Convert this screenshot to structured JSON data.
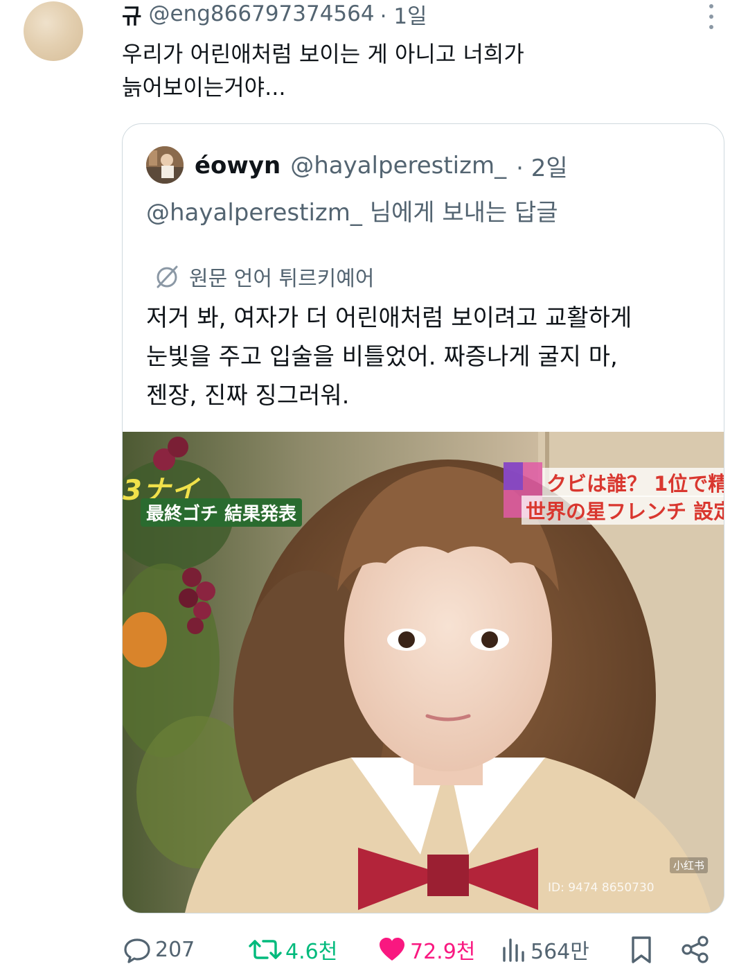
{
  "tweet": {
    "author_name": "규",
    "author_handle": "@eng866797374564",
    "time": "· 1일",
    "text_lines": [
      "우리가 어린애처럼 보이는 게 아니고 너희가",
      "늙어보이는거야..."
    ]
  },
  "quote": {
    "author_name": "éowyn",
    "author_handle": "@hayalperestizm_",
    "time": "· 2일",
    "reply_to": "@hayalperestizm_ 님에게 보내는 답글",
    "translate_label": "원문 언어 튀르키예어",
    "text_lines": [
      "저거 봐, 여자가 더 어린애처럼 보이려고 교활하게",
      "눈빛을 주고 입술을 비틀었어. 짜증나게 굴지 마,",
      "젠장, 진짜 징그러워."
    ],
    "media": {
      "caption_left_top": "3ナイ",
      "caption_left": "最終ゴチ 結果発表",
      "caption_right_1": "クビは誰？ 1位で精",
      "caption_right_2": "世界の星フレンチ 設定",
      "watermark_top": "小红书",
      "watermark_bottom": "ID: 9474 8650730"
    }
  },
  "actions": {
    "replies": "207",
    "retweets": "4.6천",
    "likes": "72.9천",
    "views": "564만"
  },
  "icons": {
    "reply": "speech-bubble-icon",
    "retweet": "retweet-arrows-icon",
    "like": "heart-icon",
    "views": "bar-chart-icon",
    "bookmark": "bookmark-icon",
    "share": "share-icon",
    "more": "vertical-ellipsis-icon",
    "translate": "globe-slash-icon"
  },
  "colors": {
    "text_primary": "#0f1419",
    "text_secondary": "#536471",
    "retweet": "#00ba7c",
    "like": "#f91880",
    "border": "#cfd9de"
  }
}
